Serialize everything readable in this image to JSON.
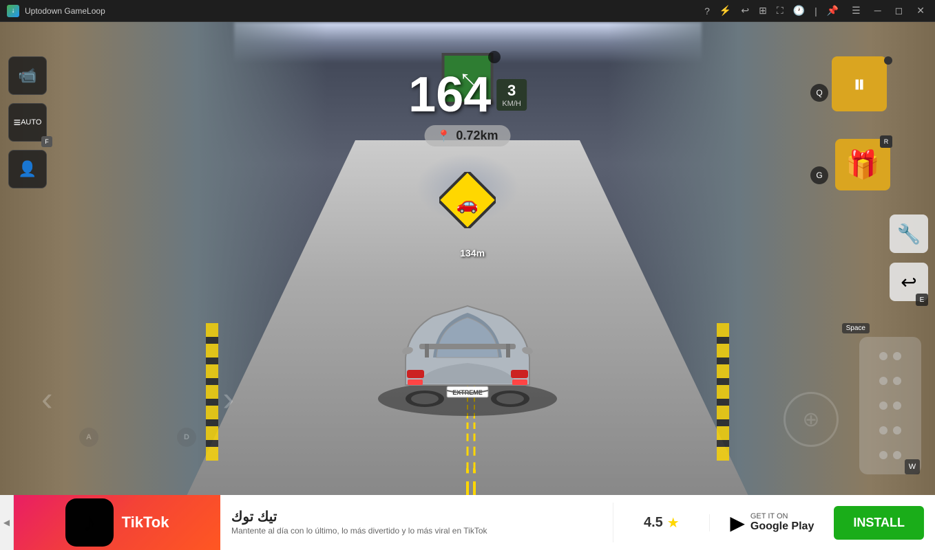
{
  "titlebar": {
    "app_name": "Uptodown GameLoop",
    "logo": "G"
  },
  "game": {
    "speed": "164",
    "gear": "3",
    "unit": "KM/H",
    "distance": "0.72km",
    "warning_distance": "134m",
    "car_plate": "EXTREME"
  },
  "hud": {
    "pause_label": "⏸",
    "q_key": "Q",
    "g_key": "G",
    "r_key": "R",
    "e_key": "E",
    "space_key": "Space",
    "w_key": "W",
    "a_key": "A",
    "d_key": "D",
    "f_key": "F",
    "auto_label": "AUTO"
  },
  "ad": {
    "app_name": "تيك توك",
    "app_desc": "Mantente al día con lo último, lo más divertido y lo más viral en TikTok",
    "rating": "4.5",
    "store_label": "GET IT ON",
    "store_name": "Google Play",
    "install_label": "INSTALL",
    "arrow_icon": "◀"
  }
}
